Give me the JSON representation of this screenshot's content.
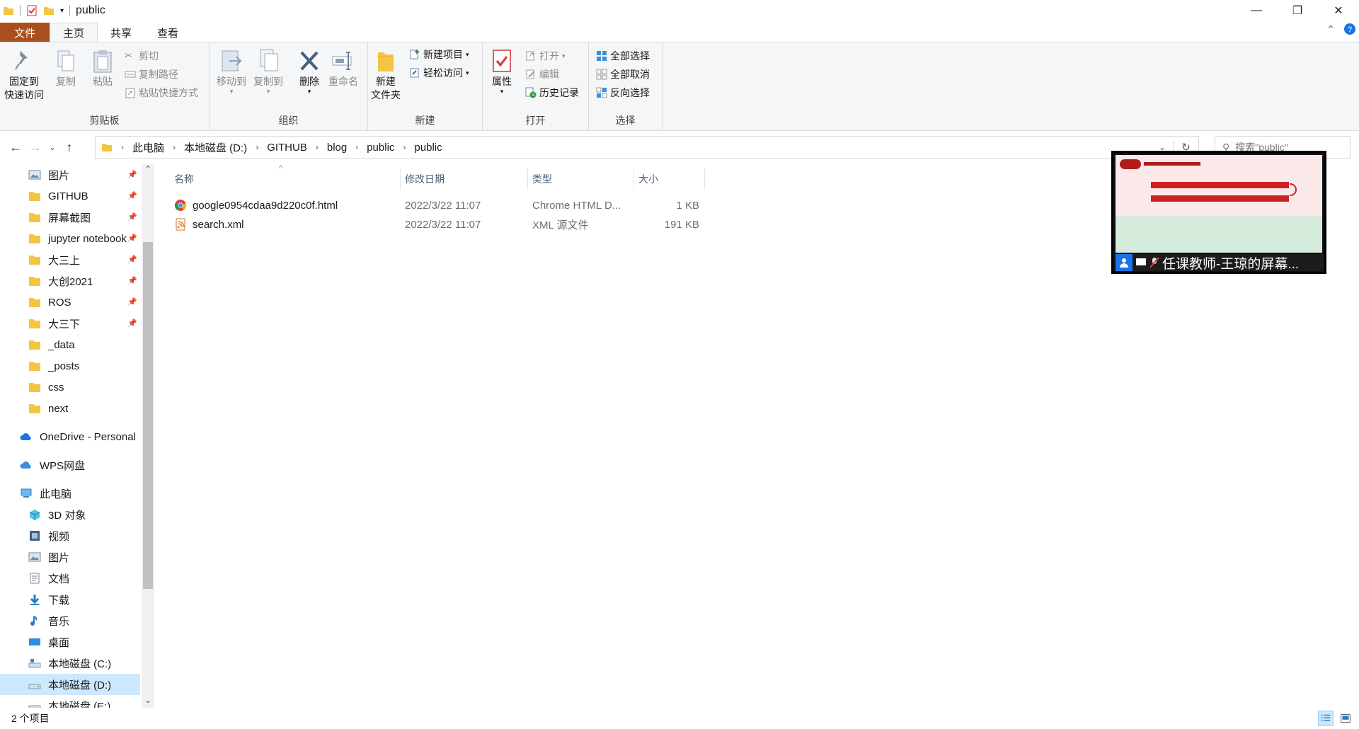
{
  "window": {
    "title": "public",
    "controls": {
      "minimize": "—",
      "maximize": "❐",
      "close": "✕"
    }
  },
  "tabs": [
    {
      "label": "文件"
    },
    {
      "label": "主页"
    },
    {
      "label": "共享"
    },
    {
      "label": "查看"
    }
  ],
  "ribbon": {
    "clipboard": {
      "label": "剪贴板",
      "pin_quick_access": "固定到\n快速访问",
      "copy": "复制",
      "paste": "粘贴",
      "cut": "剪切",
      "copy_path": "复制路径",
      "paste_shortcut": "粘贴快捷方式"
    },
    "organize": {
      "label": "组织",
      "move_to": "移动到",
      "copy_to": "复制到",
      "delete": "删除",
      "rename": "重命名"
    },
    "new": {
      "label": "新建",
      "new_folder": "新建\n文件夹",
      "new_item": "新建项目",
      "easy_access": "轻松访问"
    },
    "open": {
      "label": "打开",
      "properties": "属性",
      "open": "打开",
      "edit": "编辑",
      "history": "历史记录"
    },
    "select": {
      "label": "选择",
      "select_all": "全部选择",
      "select_none": "全部取消",
      "invert": "反向选择"
    }
  },
  "address": {
    "breadcrumbs": [
      "此电脑",
      "本地磁盘 (D:)",
      "GITHUB",
      "blog",
      "public",
      "public"
    ],
    "search_placeholder": "搜索\"public\""
  },
  "sidebar": {
    "quick_access": [
      {
        "label": "图片",
        "pinned": true
      },
      {
        "label": "GITHUB",
        "pinned": true
      },
      {
        "label": "屏幕截图",
        "pinned": true
      },
      {
        "label": "jupyter notebook",
        "pinned": true
      },
      {
        "label": "大三上",
        "pinned": true
      },
      {
        "label": "大创2021",
        "pinned": true
      },
      {
        "label": "ROS",
        "pinned": true
      },
      {
        "label": "大三下",
        "pinned": true
      },
      {
        "label": "_data",
        "pinned": false
      },
      {
        "label": "_posts",
        "pinned": false
      },
      {
        "label": "css",
        "pinned": false
      },
      {
        "label": "next",
        "pinned": false
      }
    ],
    "onedrive": "OneDrive - Personal",
    "wps": "WPS网盘",
    "this_pc": "此电脑",
    "pc_items": [
      {
        "label": "3D 对象"
      },
      {
        "label": "视频"
      },
      {
        "label": "图片"
      },
      {
        "label": "文档"
      },
      {
        "label": "下载"
      },
      {
        "label": "音乐"
      },
      {
        "label": "桌面"
      },
      {
        "label": "本地磁盘 (C:)"
      },
      {
        "label": "本地磁盘 (D:)"
      },
      {
        "label": "本地磁盘 (E:)"
      }
    ]
  },
  "file_list": {
    "columns": {
      "name": "名称",
      "modified": "修改日期",
      "type": "类型",
      "size": "大小"
    },
    "files": [
      {
        "name": "google0954cdaa9d220c0f.html",
        "modified": "2022/3/22 11:07",
        "type": "Chrome HTML D...",
        "size": "1 KB"
      },
      {
        "name": "search.xml",
        "modified": "2022/3/22 11:07",
        "type": "XML 源文件",
        "size": "191 KB"
      }
    ]
  },
  "status": {
    "item_count": "2 个项目"
  },
  "overlay": {
    "caption": "任课教师-王琼的屏幕..."
  },
  "colors": {
    "file_tab": "#a94f1f",
    "selection": "#cce8ff",
    "folder": "#f4c542"
  }
}
